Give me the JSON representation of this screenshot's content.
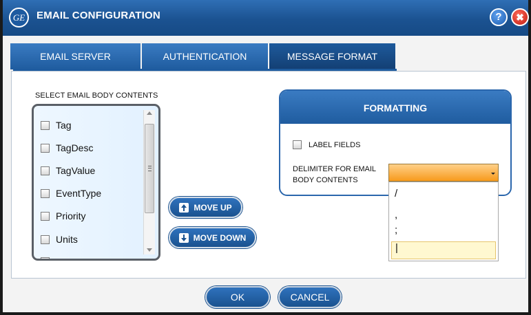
{
  "window": {
    "title": "EMAIL CONFIGURATION",
    "logo_text": "GE",
    "help_glyph": "?",
    "close_glyph": "✖"
  },
  "tabs": [
    {
      "label": "EMAIL SERVER",
      "active": false
    },
    {
      "label": "AUTHENTICATION",
      "active": false
    },
    {
      "label": "MESSAGE FORMAT",
      "active": true
    }
  ],
  "body_contents": {
    "label": "SELECT EMAIL BODY CONTENTS",
    "items": [
      {
        "label": "Tag",
        "checked": false
      },
      {
        "label": "TagDesc",
        "checked": false
      },
      {
        "label": "TagValue",
        "checked": false
      },
      {
        "label": "EventType",
        "checked": false
      },
      {
        "label": "Priority",
        "checked": false
      },
      {
        "label": "Units",
        "checked": false
      }
    ]
  },
  "move_buttons": {
    "move_up": "MOVE UP",
    "move_down": "MOVE DOWN"
  },
  "formatting": {
    "header": "FORMATTING",
    "label_fields": {
      "label": "LABEL FIELDS",
      "checked": false
    },
    "delimiter_label_line1": "DELIMITER FOR EMAIL",
    "delimiter_label_line2": "BODY CONTENTS",
    "delimiter_value": "",
    "delimiter_options": [
      "/",
      ",",
      ";",
      "|"
    ],
    "highlighted_option": "|"
  },
  "footer": {
    "ok": "OK",
    "cancel": "CANCEL"
  },
  "colors": {
    "accent": "#1f5c9f",
    "dropdown_fill": "#f79a1c",
    "close": "#c01a10"
  }
}
